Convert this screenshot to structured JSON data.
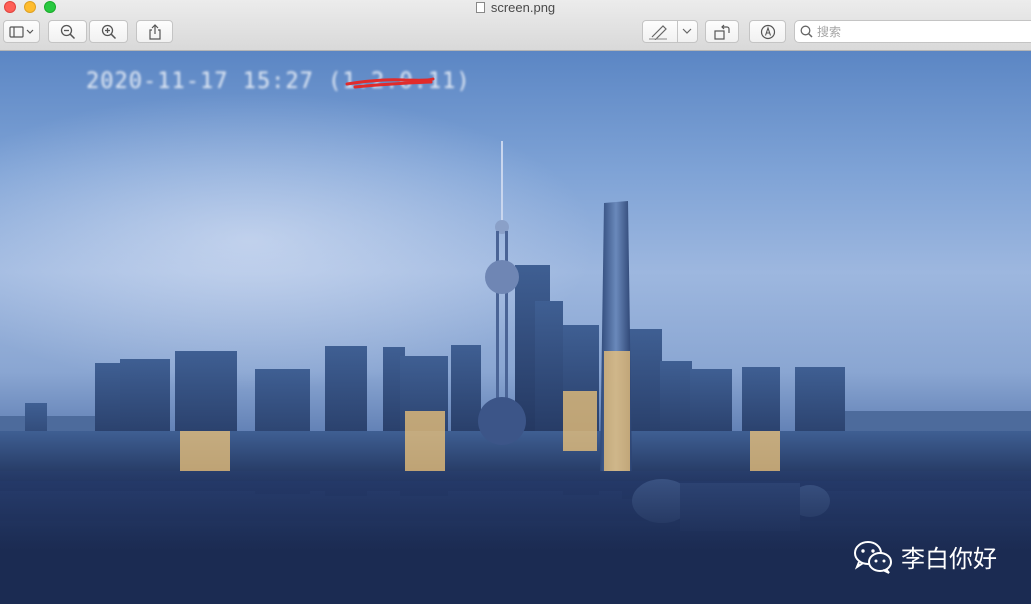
{
  "window": {
    "title": "screen.png"
  },
  "toolbar": {
    "sidebar_button": "sidebar-toggle",
    "zoom_out": "zoom-out",
    "zoom_in": "zoom-in",
    "share": "share",
    "markup": "markup",
    "rotate": "rotate",
    "annotate": "annotate"
  },
  "search": {
    "placeholder": "搜索"
  },
  "image": {
    "timestamp": "2020-11-17 15:27 (1.2.0.11)",
    "watermark": "李白你好"
  },
  "colors": {
    "close": "#fe5f57",
    "minimize": "#febc2e",
    "maximize": "#28c840",
    "scribble": "#e02b2b"
  }
}
